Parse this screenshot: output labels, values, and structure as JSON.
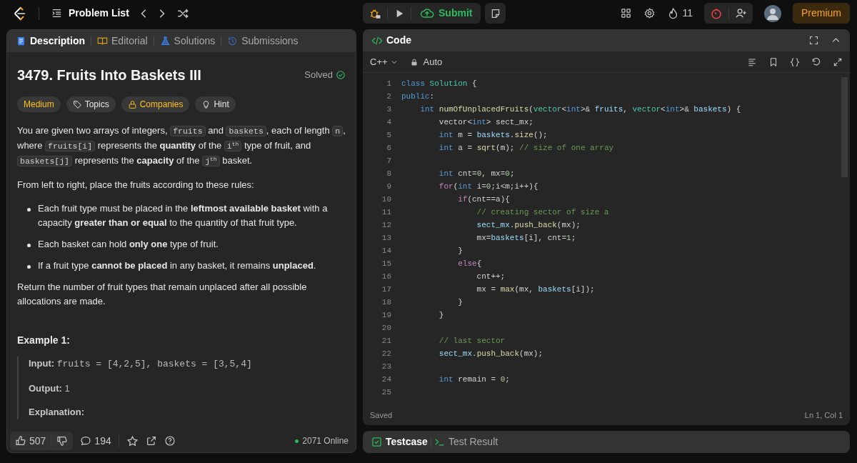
{
  "nav": {
    "problem_list": "Problem List",
    "submit": "Submit",
    "streak": "11",
    "premium": "Premium"
  },
  "description_tabs": [
    {
      "label": "Description",
      "kind": "description",
      "selected": true
    },
    {
      "label": "Editorial",
      "kind": "editorial",
      "selected": false
    },
    {
      "label": "Solutions",
      "kind": "solutions",
      "selected": false
    },
    {
      "label": "Submissions",
      "kind": "submissions",
      "selected": false
    }
  ],
  "problem": {
    "title": "3479. Fruits Into Baskets III",
    "status": "Solved",
    "difficulty": "Medium",
    "tags": [
      {
        "label": "Topics",
        "kind": "topics"
      },
      {
        "label": "Companies",
        "kind": "companies"
      },
      {
        "label": "Hint",
        "kind": "hint"
      }
    ]
  },
  "description": [
    {
      "kind": "paragraph",
      "segments": [
        {
          "kind": "text",
          "text": "You are given two arrays of integers, "
        },
        {
          "kind": "code",
          "text": "fruits"
        },
        {
          "kind": "text",
          "text": " and "
        },
        {
          "kind": "code",
          "text": "baskets"
        },
        {
          "kind": "text",
          "text": ", each of length "
        },
        {
          "kind": "code",
          "text": "n"
        },
        {
          "kind": "text",
          "text": ", where "
        },
        {
          "kind": "code",
          "text": "fruits[i]"
        },
        {
          "kind": "text",
          "text": " represents the "
        },
        {
          "kind": "bold",
          "text": "quantity"
        },
        {
          "kind": "text",
          "text": " of the "
        },
        {
          "kind": "code",
          "text": "i",
          "sup": "th"
        },
        {
          "kind": "text",
          "text": " type of fruit, and "
        },
        {
          "kind": "code",
          "text": "baskets[j]"
        },
        {
          "kind": "text",
          "text": " represents the "
        },
        {
          "kind": "bold",
          "text": "capacity"
        },
        {
          "kind": "text",
          "text": " of the "
        },
        {
          "kind": "code",
          "text": "j",
          "sup": "th"
        },
        {
          "kind": "text",
          "text": " basket."
        }
      ]
    },
    {
      "kind": "paragraph",
      "segments": [
        {
          "kind": "text",
          "text": "From left to right, place the fruits according to these rules:"
        }
      ]
    },
    {
      "kind": "bullet",
      "segments": [
        {
          "kind": "text",
          "text": "Each fruit type must be placed in the "
        },
        {
          "kind": "bold",
          "text": "leftmost available basket"
        },
        {
          "kind": "text",
          "text": " with a capacity "
        },
        {
          "kind": "bold",
          "text": "greater than or equal"
        },
        {
          "kind": "text",
          "text": " to the quantity of that fruit type."
        }
      ]
    },
    {
      "kind": "bullet",
      "segments": [
        {
          "kind": "text",
          "text": "Each basket can hold "
        },
        {
          "kind": "bold",
          "text": "only one"
        },
        {
          "kind": "text",
          "text": " type of fruit."
        }
      ]
    },
    {
      "kind": "bullet",
      "segments": [
        {
          "kind": "text",
          "text": "If a fruit type "
        },
        {
          "kind": "bold",
          "text": "cannot be placed"
        },
        {
          "kind": "text",
          "text": " in any basket, it remains "
        },
        {
          "kind": "bold",
          "text": "unplaced"
        },
        {
          "kind": "text",
          "text": "."
        }
      ]
    },
    {
      "kind": "paragraph",
      "segments": [
        {
          "kind": "text",
          "text": "Return the number of fruit types that remain unplaced after all possible allocations are made."
        }
      ]
    }
  ],
  "example": {
    "title": "Example 1:",
    "items": [
      {
        "label": "Input:",
        "value": "fruits = [4,2,5], baskets = [3,5,4]",
        "kind": "code"
      },
      {
        "label": "Output:",
        "value": "1",
        "kind": "text"
      },
      {
        "label": "Explanation:"
      }
    ]
  },
  "footer": {
    "likes": "507",
    "comments": "194",
    "online": "2071 Online"
  },
  "editor": {
    "title": "Code",
    "language": "C++",
    "mode": "Auto",
    "status": "Saved",
    "cursor": "Ln 1, Col 1",
    "lines": [
      {
        "number": "1",
        "tokens": [
          {
            "kind": "kw",
            "text": "class "
          },
          {
            "kind": "type",
            "text": "Solution"
          },
          {
            "kind": "plain",
            "text": " {"
          }
        ]
      },
      {
        "number": "2",
        "tokens": [
          {
            "kind": "kw",
            "text": "public"
          },
          {
            "kind": "plain",
            "text": ":"
          }
        ]
      },
      {
        "number": "3",
        "tokens": [
          {
            "kind": "kw",
            "text": "    int "
          },
          {
            "kind": "fn",
            "text": "numOfUnplacedFruits"
          },
          {
            "kind": "plain",
            "text": "("
          },
          {
            "kind": "type",
            "text": "vector"
          },
          {
            "kind": "plain",
            "text": "<"
          },
          {
            "kind": "kw",
            "text": "int"
          },
          {
            "kind": "plain",
            "text": ">& "
          },
          {
            "kind": "var",
            "text": "fruits"
          },
          {
            "kind": "plain",
            "text": ", "
          },
          {
            "kind": "type",
            "text": "vector"
          },
          {
            "kind": "plain",
            "text": "<"
          },
          {
            "kind": "kw",
            "text": "int"
          },
          {
            "kind": "plain",
            "text": ">& "
          },
          {
            "kind": "var",
            "text": "baskets"
          },
          {
            "kind": "plain",
            "text": ") {"
          }
        ]
      },
      {
        "number": "4",
        "tokens": [
          {
            "kind": "plain",
            "text": "        vector<"
          },
          {
            "kind": "kw",
            "text": "int"
          },
          {
            "kind": "plain",
            "text": "> sect_mx;"
          }
        ]
      },
      {
        "number": "5",
        "tokens": [
          {
            "kind": "kw",
            "text": "        int"
          },
          {
            "kind": "plain",
            "text": " m = "
          },
          {
            "kind": "var",
            "text": "baskets"
          },
          {
            "kind": "plain",
            "text": "."
          },
          {
            "kind": "fn",
            "text": "size"
          },
          {
            "kind": "plain",
            "text": "();"
          }
        ]
      },
      {
        "number": "6",
        "tokens": [
          {
            "kind": "kw",
            "text": "        int"
          },
          {
            "kind": "plain",
            "text": " a = "
          },
          {
            "kind": "fn",
            "text": "sqrt"
          },
          {
            "kind": "plain",
            "text": "(m); "
          },
          {
            "kind": "comment",
            "text": "// size of one array"
          }
        ]
      },
      {
        "number": "7"
      },
      {
        "number": "8",
        "tokens": [
          {
            "kind": "kw",
            "text": "        int"
          },
          {
            "kind": "plain",
            "text": " cnt="
          },
          {
            "kind": "num",
            "text": "0"
          },
          {
            "kind": "plain",
            "text": ", mx="
          },
          {
            "kind": "num",
            "text": "0"
          },
          {
            "kind": "plain",
            "text": ";"
          }
        ]
      },
      {
        "number": "9",
        "tokens": [
          {
            "kind": "ctl",
            "text": "        for"
          },
          {
            "kind": "plain",
            "text": "("
          },
          {
            "kind": "kw",
            "text": "int"
          },
          {
            "kind": "plain",
            "text": " i="
          },
          {
            "kind": "num",
            "text": "0"
          },
          {
            "kind": "plain",
            "text": ";i<m;i++){"
          }
        ]
      },
      {
        "number": "10",
        "tokens": [
          {
            "kind": "ctl",
            "text": "            if"
          },
          {
            "kind": "plain",
            "text": "(cnt==a){"
          }
        ]
      },
      {
        "number": "11",
        "tokens": [
          {
            "kind": "comment",
            "text": "                // creating sector of size a"
          }
        ]
      },
      {
        "number": "12",
        "tokens": [
          {
            "kind": "var",
            "text": "                sect_mx"
          },
          {
            "kind": "plain",
            "text": "."
          },
          {
            "kind": "fn",
            "text": "push_back"
          },
          {
            "kind": "plain",
            "text": "(mx);"
          }
        ]
      },
      {
        "number": "13",
        "tokens": [
          {
            "kind": "plain",
            "text": "                mx="
          },
          {
            "kind": "var",
            "text": "baskets"
          },
          {
            "kind": "plain",
            "text": "[i], cnt="
          },
          {
            "kind": "num",
            "text": "1"
          },
          {
            "kind": "plain",
            "text": ";"
          }
        ]
      },
      {
        "number": "14",
        "tokens": [
          {
            "kind": "plain",
            "text": "            }"
          }
        ]
      },
      {
        "number": "15",
        "tokens": [
          {
            "kind": "ctl",
            "text": "            else"
          },
          {
            "kind": "plain",
            "text": "{"
          }
        ]
      },
      {
        "number": "16",
        "tokens": [
          {
            "kind": "plain",
            "text": "                cnt++;"
          }
        ]
      },
      {
        "number": "17",
        "tokens": [
          {
            "kind": "plain",
            "text": "                mx = "
          },
          {
            "kind": "fn",
            "text": "max"
          },
          {
            "kind": "plain",
            "text": "(mx, "
          },
          {
            "kind": "var",
            "text": "baskets"
          },
          {
            "kind": "plain",
            "text": "[i]);"
          }
        ]
      },
      {
        "number": "18",
        "tokens": [
          {
            "kind": "plain",
            "text": "            }"
          }
        ]
      },
      {
        "number": "19",
        "tokens": [
          {
            "kind": "plain",
            "text": "        }"
          }
        ]
      },
      {
        "number": "20"
      },
      {
        "number": "21",
        "tokens": [
          {
            "kind": "comment",
            "text": "        // last sector"
          }
        ]
      },
      {
        "number": "22",
        "tokens": [
          {
            "kind": "var",
            "text": "        sect_mx"
          },
          {
            "kind": "plain",
            "text": "."
          },
          {
            "kind": "fn",
            "text": "push_back"
          },
          {
            "kind": "plain",
            "text": "(mx);"
          }
        ]
      },
      {
        "number": "23"
      },
      {
        "number": "24",
        "tokens": [
          {
            "kind": "kw",
            "text": "        int"
          },
          {
            "kind": "plain",
            "text": " remain = "
          },
          {
            "kind": "num",
            "text": "0"
          },
          {
            "kind": "plain",
            "text": ";"
          }
        ]
      },
      {
        "number": "25"
      }
    ]
  },
  "bottom_tabs": [
    {
      "label": "Testcase",
      "kind": "testcase",
      "selected": true
    },
    {
      "label": "Test Result",
      "kind": "result",
      "selected": false
    }
  ]
}
